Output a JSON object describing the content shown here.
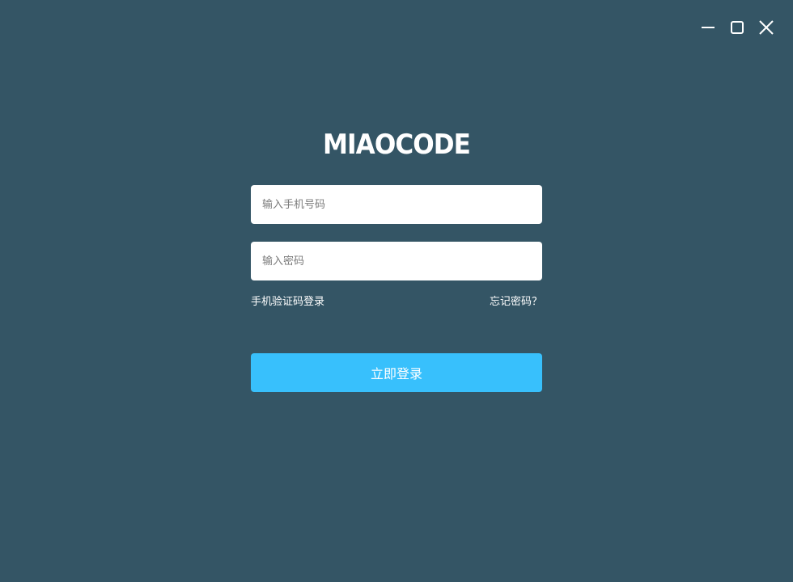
{
  "window": {
    "controls": [
      {
        "icon": "minimize-icon"
      },
      {
        "icon": "maximize-icon"
      },
      {
        "icon": "close-icon"
      }
    ]
  },
  "logo": {
    "text": "MIAOCODE"
  },
  "form": {
    "phone_placeholder": "输入手机号码",
    "phone_value": "",
    "password_placeholder": "输入密码",
    "password_value": "",
    "sms_login_link": "手机验证码登录",
    "forgot_password_link": "忘记密码？",
    "login_button": "立即登录"
  },
  "colors": {
    "background": "#345565",
    "accent": "#38c0fc",
    "text": "#ffffff"
  }
}
